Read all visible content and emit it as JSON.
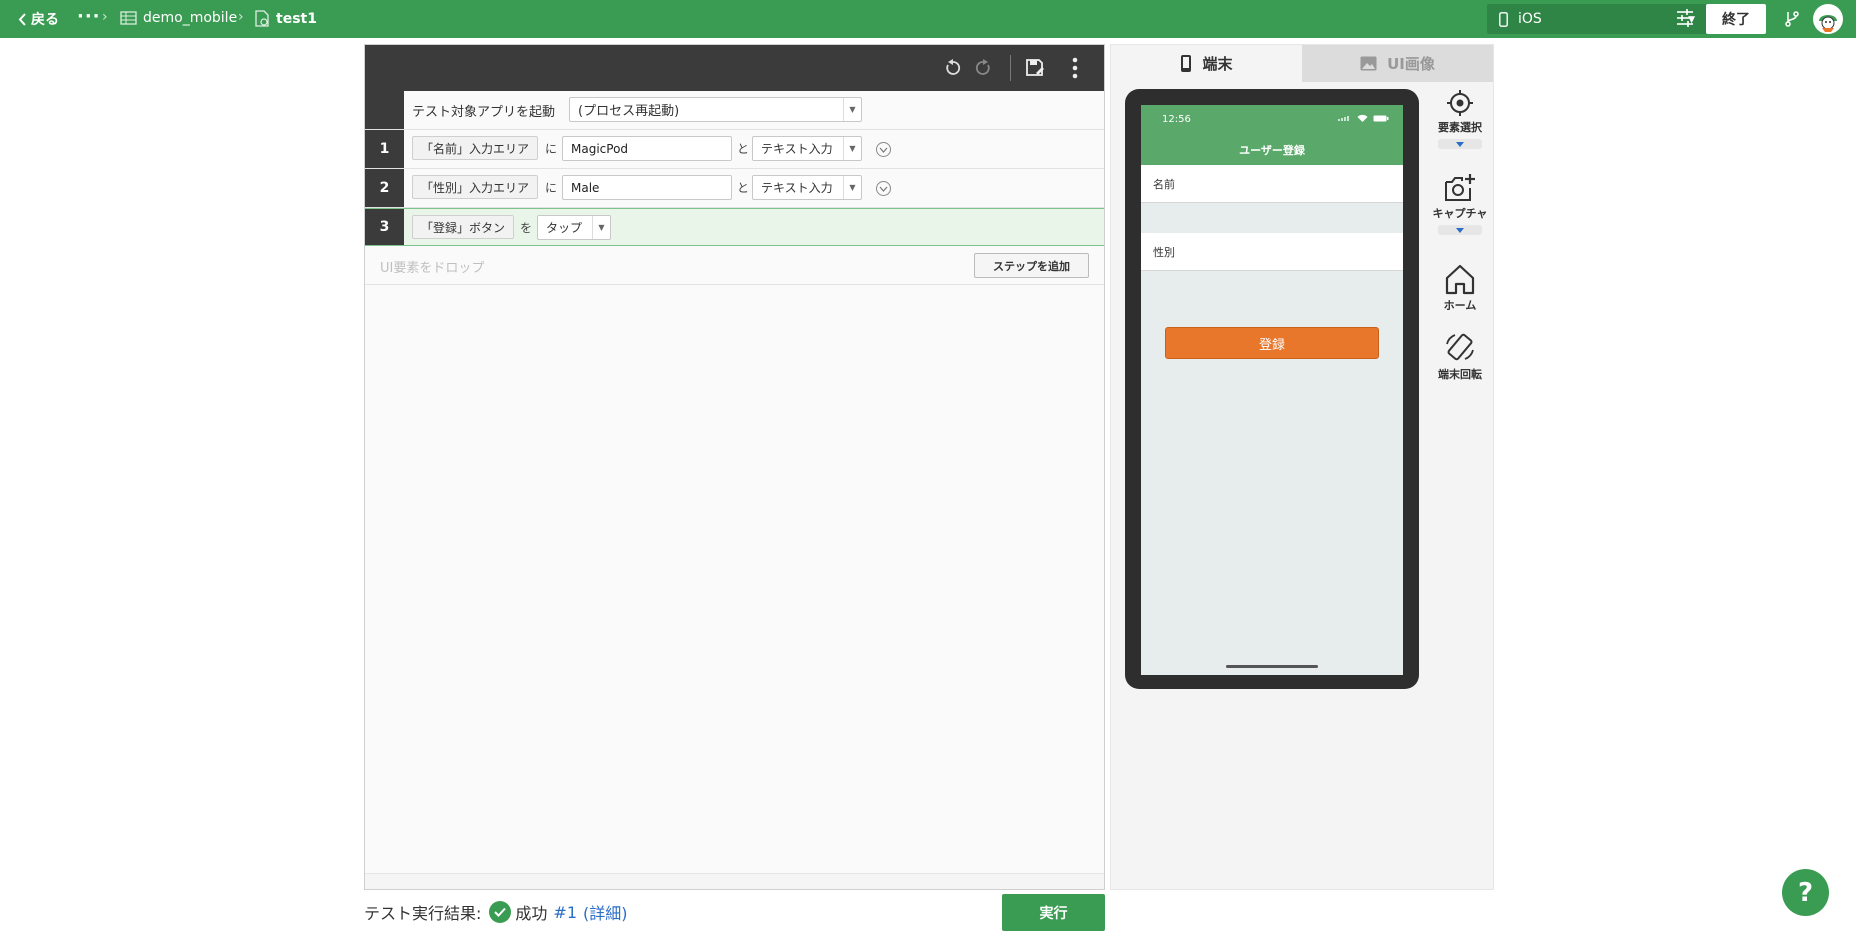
{
  "topbar": {
    "back_label": "戻る",
    "breadcrumbs": [
      "demo_mobile",
      "test1"
    ],
    "device_select": "iOS",
    "end_label": "終了"
  },
  "editor": {
    "start_row": {
      "text": "テスト対象アプリを起動",
      "option": "(プロセス再起動)"
    },
    "steps": [
      {
        "num": "1",
        "element": "「名前」入力エリア",
        "particle1": "に",
        "value": "MagicPod",
        "particle2": "と",
        "action": "テキスト入力"
      },
      {
        "num": "2",
        "element": "「性別」入力エリア",
        "particle1": "に",
        "value": "Male",
        "particle2": "と",
        "action": "テキスト入力"
      },
      {
        "num": "3",
        "element": "「登録」ボタン",
        "particle1": "を",
        "action": "タップ"
      }
    ],
    "drop_hint": "UI要素をドロップ",
    "add_step_label": "ステップを追加"
  },
  "result": {
    "label": "テスト実行結果:",
    "status": "成功",
    "run_link": "#1",
    "detail_link": "(詳細)"
  },
  "run_label": "実行",
  "panel": {
    "tabs": [
      "端末",
      "UI画像"
    ],
    "phone": {
      "time": "12:56",
      "title": "ユーザー登録",
      "field1": "名前",
      "field2": "性別",
      "button": "登録"
    },
    "tools": [
      "要素選択",
      "キャプチャ",
      "ホーム",
      "端末回転"
    ]
  },
  "help_label": "?",
  "colors": {
    "brand_green": "#3a9c52",
    "app_green": "#5aa86a",
    "app_button": "#e8772c"
  }
}
